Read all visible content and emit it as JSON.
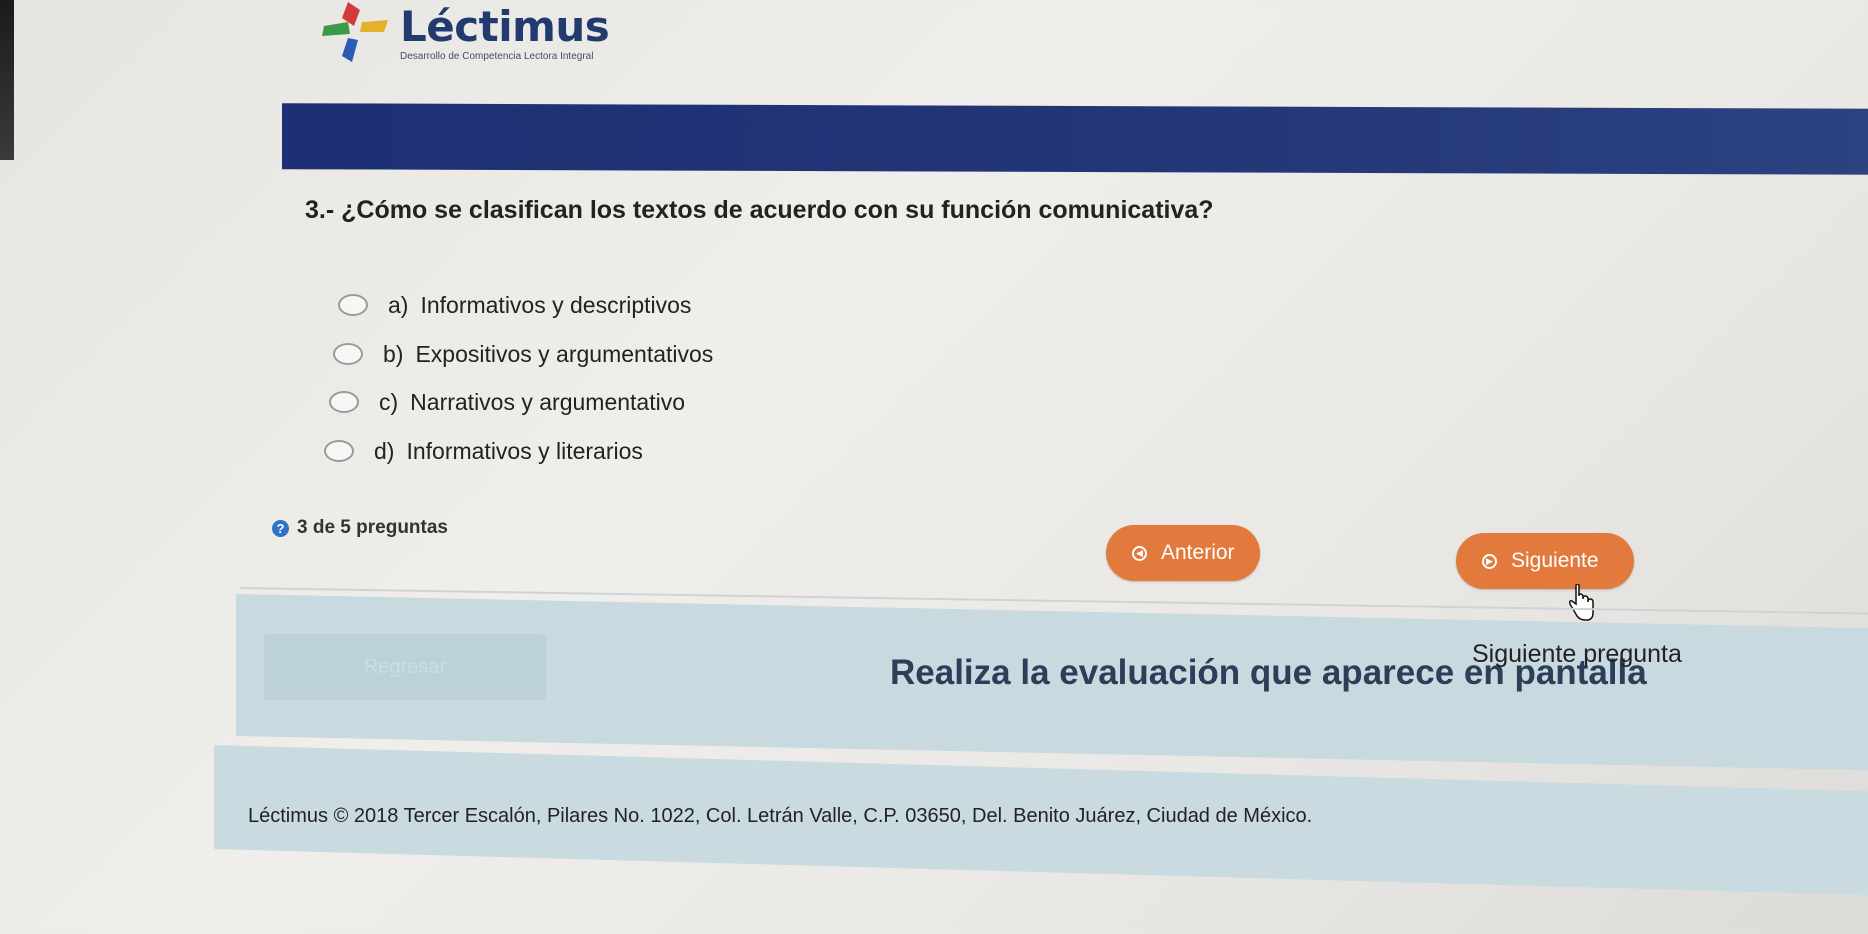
{
  "logo": {
    "title": "Léctimus",
    "subtitle": "Desarrollo de Competencia Lectora Integral"
  },
  "question": {
    "text": "3.- ¿Cómo se clasifican los textos de acuerdo con su función comunicativa?"
  },
  "options": [
    {
      "letter": "a)",
      "text": "Informativos y descriptivos"
    },
    {
      "letter": "b)",
      "text": "Expositivos y argumentativos"
    },
    {
      "letter": "c)",
      "text": "Narrativos y argumentativo"
    },
    {
      "letter": "d)",
      "text": "Informativos y literarios"
    }
  ],
  "progress": {
    "counter": "3 de 5 preguntas",
    "icon": "?"
  },
  "nav": {
    "previous_label": "Anterior",
    "next_label": "Siguiente",
    "tooltip": "Siguiente pregunta"
  },
  "banner": {
    "back_label": "Regresar",
    "text": "Realiza la evaluación que aparece en pantalla"
  },
  "footer": {
    "text": "Léctimus © 2018 Tercer Escalón, Pilares No. 1022, Col. Letrán Valle, C.P. 03650, Del. Benito Juárez, Ciudad de México."
  },
  "colors": {
    "header_blue": "#233677",
    "button_orange": "#e27a3e",
    "banner_teal": "#c8d9e0",
    "help_blue": "#2f73c9"
  }
}
